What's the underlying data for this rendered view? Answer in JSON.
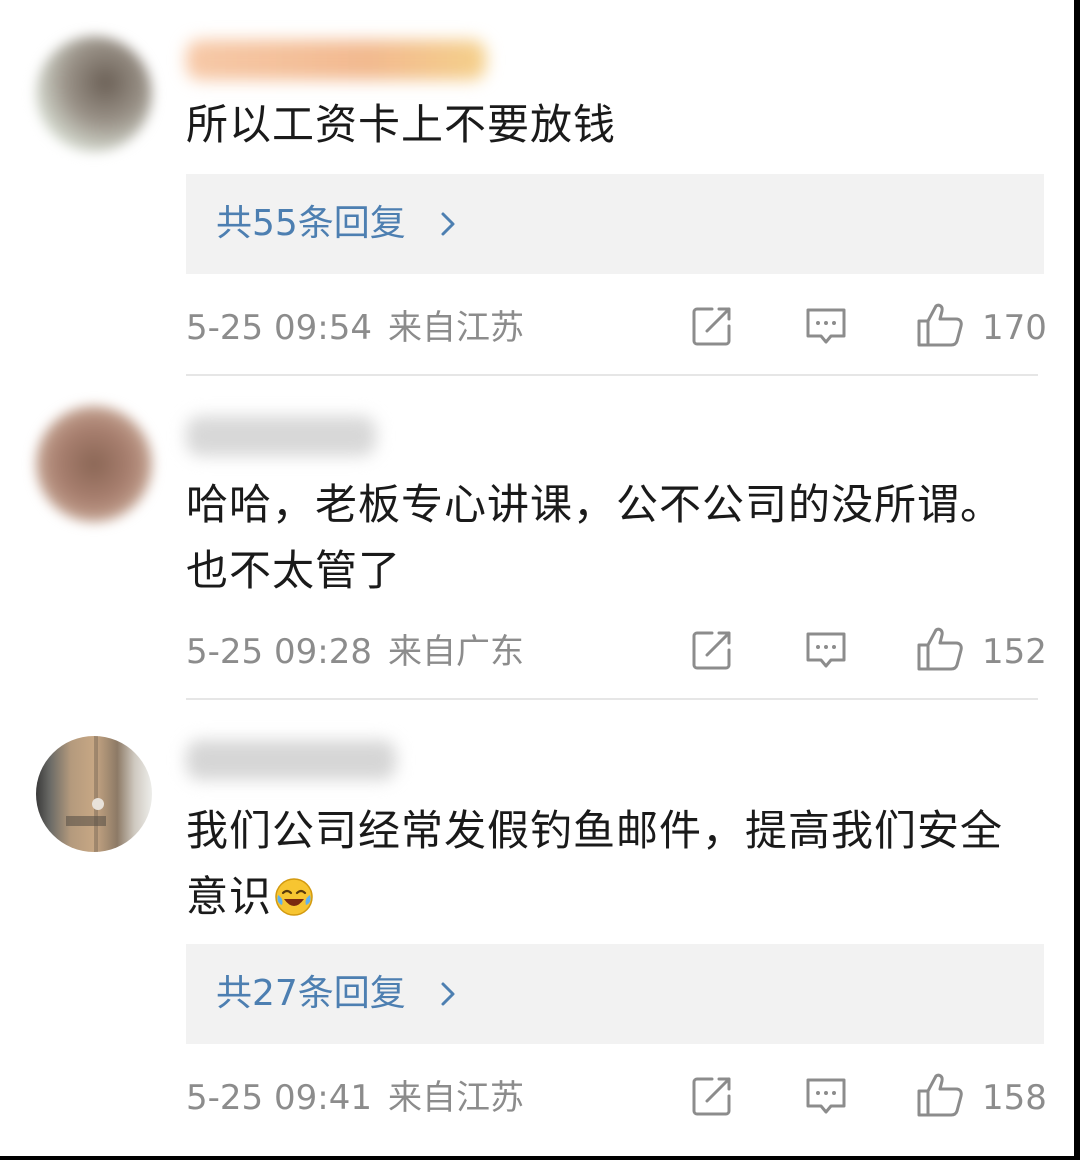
{
  "comments": [
    {
      "text": "所以工资卡上不要放钱",
      "replies_label": "共55条回复",
      "time": "5-25 09:54",
      "location": "来自江苏",
      "likes": "170"
    },
    {
      "text": "哈哈，老板专心讲课，公不公司的没所谓。也不太管了",
      "time": "5-25 09:28",
      "location": "来自广东",
      "likes": "152"
    },
    {
      "text": "我们公司经常发假钓鱼邮件，提高我们安全意识",
      "replies_label": "共27条回复",
      "time": "5-25 09:41",
      "location": "来自江苏",
      "likes": "158",
      "emoji": "crying-laughing-emoji"
    }
  ],
  "icons": {
    "share": "share-icon",
    "comment": "comment-icon",
    "like": "thumbs-up-icon",
    "chevron": "chevron-right-icon"
  },
  "colors": {
    "link": "#4d7fb1",
    "meta": "#8c8c8c",
    "text": "#1a1a1a",
    "reply_bg": "#f2f2f2"
  }
}
